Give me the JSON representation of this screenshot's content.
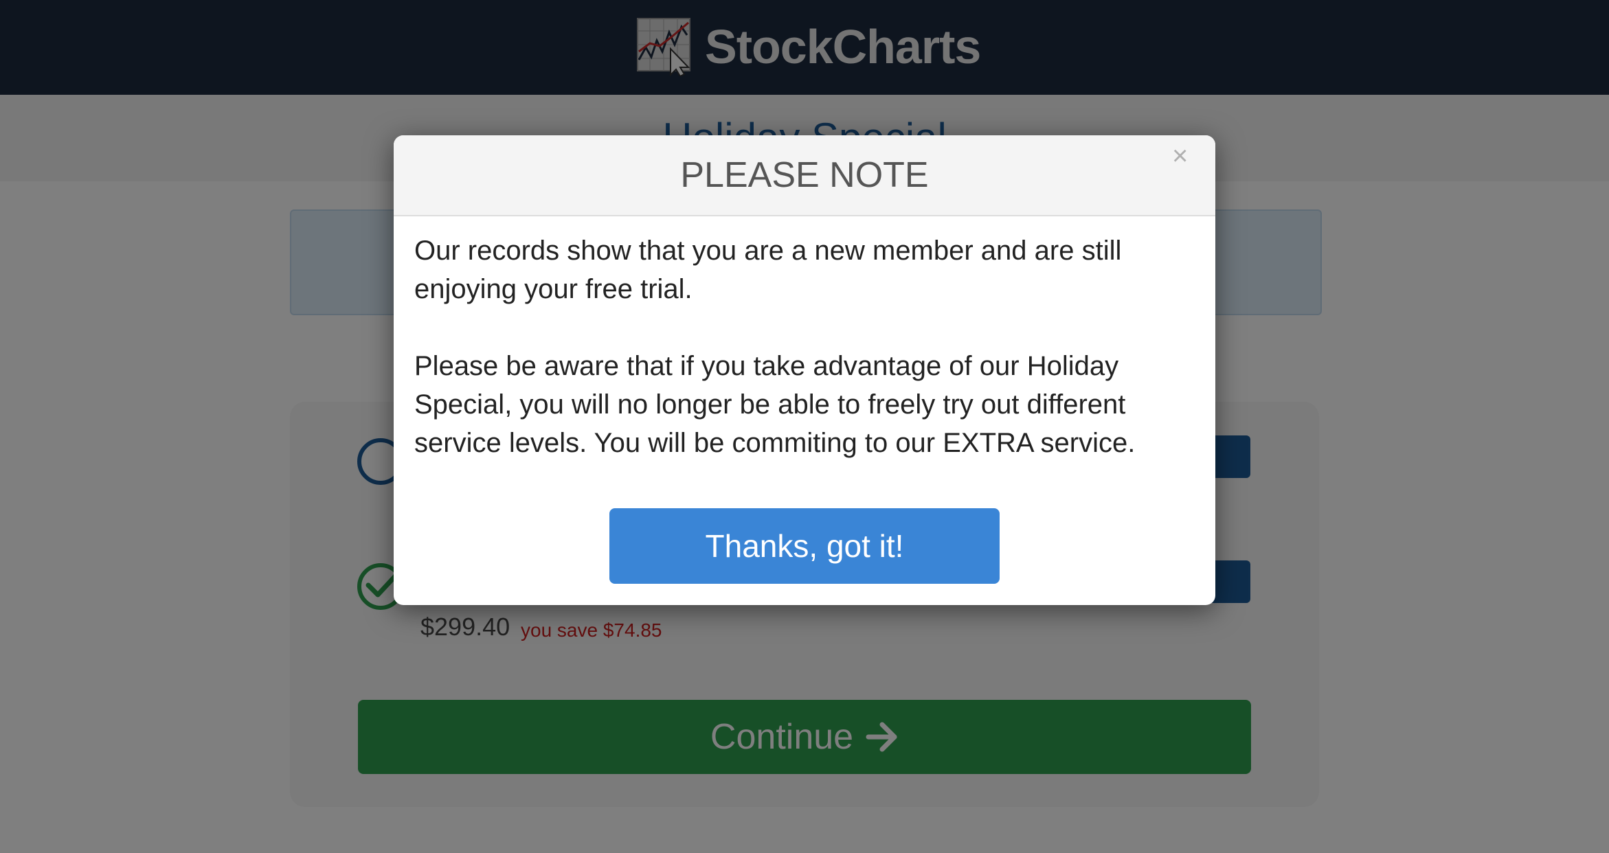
{
  "header": {
    "brand": "StockCharts",
    "logo_icon": "stockcharts-logo-icon"
  },
  "page": {
    "title": "Holiday Special",
    "plan_price": "$299.40",
    "plan_savings": "you save $74.85",
    "continue_label": "Continue",
    "continue_icon": "arrow-right-icon"
  },
  "modal": {
    "title": "PLEASE NOTE",
    "close_glyph": "×",
    "paragraph_1": "Our records show that you are a new member and are still enjoying your free trial.",
    "paragraph_2": "Please be aware that if you take advantage of our Holiday Special, you will no longer be able to freely try out different service levels. You will be commiting to our EXTRA service.",
    "button_label": "Thanks, got it!"
  },
  "colors": {
    "nav_bg": "#1d2b3f",
    "accent_blue": "#1c5a96",
    "button_blue": "#3a85d6",
    "continue_green": "#2e9e4f",
    "savings_red": "#c81d1d"
  }
}
